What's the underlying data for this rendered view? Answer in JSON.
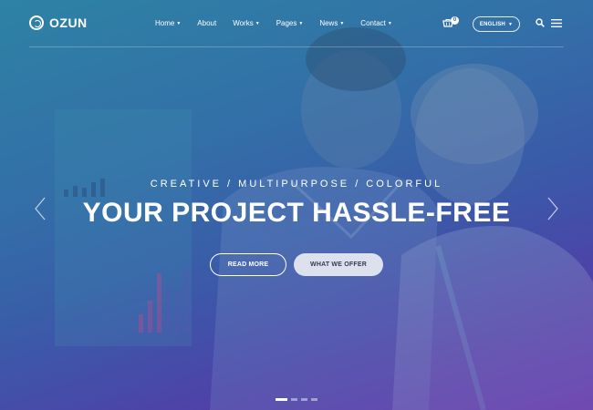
{
  "header": {
    "logo_text": "OZUN",
    "nav": [
      {
        "label": "Home",
        "has_dropdown": true
      },
      {
        "label": "About",
        "has_dropdown": false
      },
      {
        "label": "Works",
        "has_dropdown": true
      },
      {
        "label": "Pages",
        "has_dropdown": true
      },
      {
        "label": "News",
        "has_dropdown": true
      },
      {
        "label": "Contact",
        "has_dropdown": true
      }
    ],
    "cart_count": "0",
    "language": "ENGLISH",
    "icons": [
      "logo-ring-icon",
      "cart-icon",
      "search-icon",
      "hamburger-menu-icon",
      "chevron-down-icon"
    ]
  },
  "hero": {
    "tagline": "CREATIVE / MULTIPURPOSE / COLORFUL",
    "title": "YOUR PROJECT HASSLE-FREE",
    "primary_button": "READ MORE",
    "secondary_button": "WHAT WE OFFER",
    "slides_total": 4,
    "active_slide": 1
  },
  "colors": {
    "gradient_top": "#2f7fa6",
    "gradient_mid": "#3b55a8",
    "gradient_bottom": "#5a2ea6",
    "button_solid_bg": "#dde1ee",
    "text": "#ffffff"
  }
}
